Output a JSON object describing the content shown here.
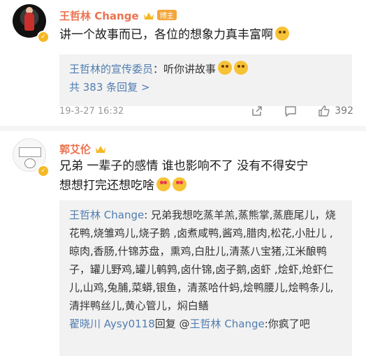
{
  "comment1": {
    "author": "王哲林 Change",
    "badge": "博主",
    "text": "讲一个故事而已，各位的想象力真丰富啊",
    "reply_author": "王哲林的宣传委员",
    "reply_text": "：听你讲故事",
    "more_replies": "共 383 条回复 >",
    "timestamp": "19-3-27 16:32",
    "like_count": "392"
  },
  "comment2": {
    "author": "郭艾伦",
    "text_line1": "兄弟 一辈子的感情 谁也影响不了 没有不得安宁",
    "text_line2": "想想打完还想吃啥",
    "reply1_author": "王哲林 Change",
    "reply1_text": ": 兄弟我想吃蒸羊羔,蒸熊掌,蒸鹿尾儿，烧花鸭,烧雏鸡儿,烧子鹅 ,卤煮咸鸭,酱鸡,腊肉,松花,小肚儿 ,晾肉,香肠,什锦苏盘，熏鸡,白肚儿,清蒸八宝猪,江米酿鸭子，罐儿野鸡,罐儿鹌鹑,卤什锦,卤子鹅,卤虾 ,烩虾,炝虾仁儿,山鸡,兔脯,菜蟒,银鱼，清蒸哈什蚂,烩鸭腰儿,烩鸭条儿,清拌鸭丝儿,黄心管儿，焖白鳝",
    "reply2_author": "翟晓川 Aysy0118",
    "reply2_middle": "回复 @",
    "reply2_target": "王哲林 Change",
    "reply2_text": ":你疯了吧"
  },
  "icons": {
    "share": "share-icon",
    "comment": "comment-icon",
    "like": "thumbs-up-icon",
    "verified": "verified-badge-icon",
    "crown": "crown-icon"
  },
  "colors": {
    "username": "#eb7350",
    "link": "#507daf",
    "badge": "#f3a63b",
    "reply_bg": "#f2f2f2"
  }
}
